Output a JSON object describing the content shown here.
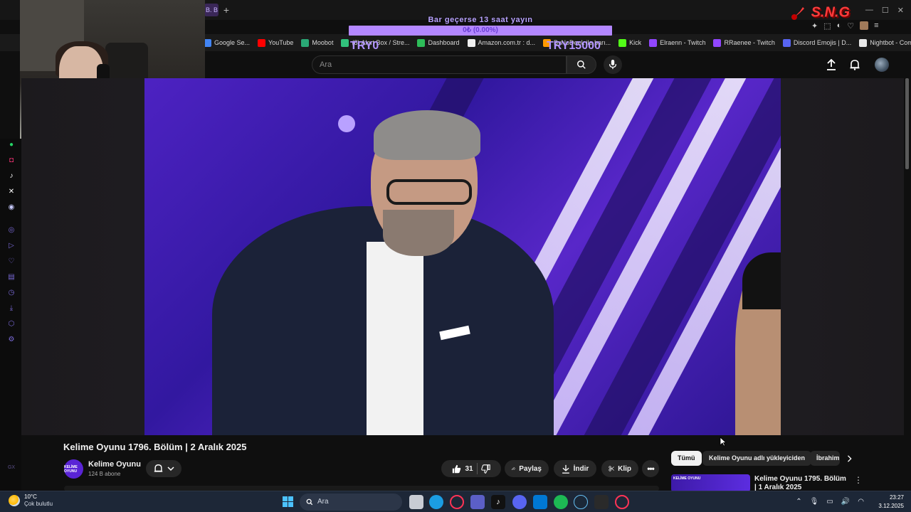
{
  "browser": {
    "active_tab_label": "B. B",
    "new_tab_symbol": "+",
    "bookmarks": [
      {
        "label": "Google Se...",
        "color": "#4285f4",
        "icon": "google-icon"
      },
      {
        "label": "YouTube",
        "color": "#ff0000",
        "icon": "youtube-icon"
      },
      {
        "label": "Moobot",
        "color": "#2aa876",
        "icon": "moobot-icon"
      },
      {
        "label": "(8) Alert Box / Stre...",
        "color": "#31c27c",
        "icon": "alert-box-icon"
      },
      {
        "label": "Dashboard",
        "color": "#2ebd59",
        "icon": "dashboard-icon"
      },
      {
        "label": "Amazon.com.tr : d...",
        "color": "#f0f0f0",
        "icon": "amazon-icon"
      },
      {
        "label": "ByNoDeek ile barı...",
        "color": "#ff9900",
        "icon": "bynodeek-icon"
      },
      {
        "label": "Kick",
        "color": "#53fc18",
        "icon": "kick-icon"
      },
      {
        "label": "Elraenn - Twitch",
        "color": "#9146ff",
        "icon": "twitch-icon"
      },
      {
        "label": "RRaenee - Twitch",
        "color": "#9146ff",
        "icon": "twitch-icon"
      },
      {
        "label": "Discord Emojis | D...",
        "color": "#5865f2",
        "icon": "discord-icon"
      },
      {
        "label": "Nightbot - Comma...",
        "color": "#e8e8e8",
        "icon": "nightbot-icon"
      }
    ]
  },
  "stream_overlay": {
    "bar_title": "Bar geçerse 13 saat yayın",
    "bar_progress_text": "0₺ (0.00%)",
    "bar_progress_fraction": 0.0,
    "bar_min": "TRY0",
    "bar_max": "TRY15000",
    "logo_text": "S.N.G"
  },
  "youtube": {
    "search_placeholder": "Ara",
    "video_title": "Kelime Oyunu 1796. Bölüm | 2 Aralık 2025",
    "channel_name": "Kelime Oyunu",
    "channel_subs": "124 B abone",
    "channel_avatar_text": "KELİME OYUNU",
    "like_count": "31",
    "share_label": "Paylaş",
    "download_label": "İndir",
    "clip_label": "Klip",
    "chips": [
      {
        "label": "Tümü",
        "active": true
      },
      {
        "label": "Kelime Oyunu adlı yükleyiciden",
        "active": false
      },
      {
        "label": "İbrahim",
        "active": false
      }
    ],
    "recommended": {
      "title": "Kelime Oyunu 1795. Bölüm | 1 Aralık 2025",
      "thumb_text": "KELİME OYUNU"
    }
  },
  "taskbar": {
    "temperature": "10°C",
    "weather_desc": "Çok bulutlu",
    "search_placeholder": "Ara",
    "time": "23:27",
    "date": "3.12.2025"
  },
  "colors": {
    "accent_purple": "#9146ff",
    "youtube_bg": "#0f0f0f",
    "taskbar_bg": "#1d2737"
  }
}
